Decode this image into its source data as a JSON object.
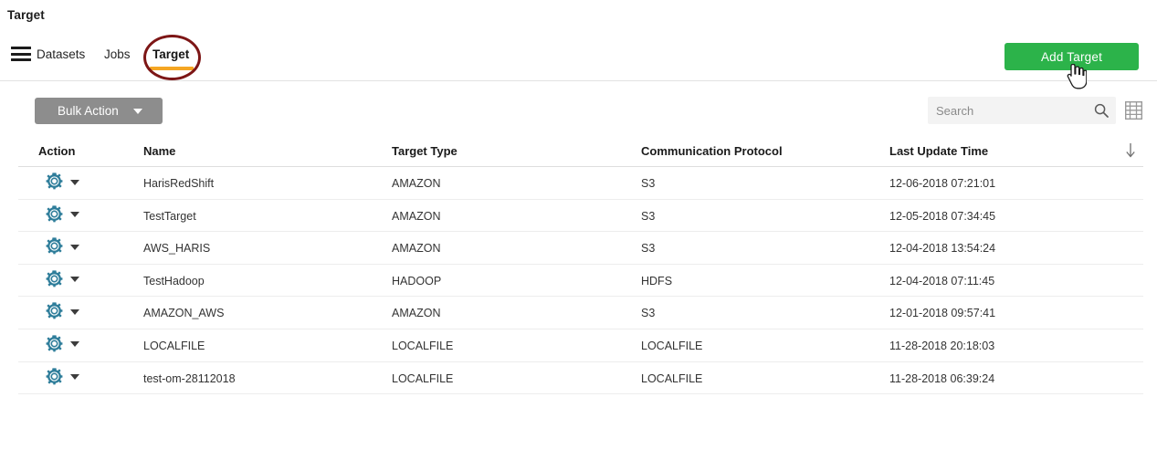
{
  "page": {
    "title": "Target"
  },
  "nav": {
    "menu_icon": "hamburger-icon",
    "tabs": [
      {
        "label": "Datasets",
        "active": false
      },
      {
        "label": "Jobs",
        "active": false
      },
      {
        "label": "Target",
        "active": true
      }
    ],
    "active_underline_color": "#f5a623",
    "annotation_color": "#7d1616"
  },
  "toolbar": {
    "add_target_label": "Add Target",
    "add_target_color": "#2cb34a",
    "bulk_action_label": "Bulk Action",
    "bulk_action_color": "#8d8d8d",
    "search_placeholder": "Search",
    "search_value": "",
    "search_icon": "search-icon",
    "grid_view_icon": "table-grid-icon",
    "cursor_icon": "pointer-hand-cursor"
  },
  "table": {
    "columns": [
      "Action",
      "Name",
      "Target Type",
      "Communication Protocol",
      "Last Update Time"
    ],
    "sort_icon": "sort-descending-arrow",
    "row_action_icon": "gear-icon",
    "row_action_caret": "chevron-down-icon",
    "rows": [
      {
        "name": "HarisRedShift",
        "target_type": "AMAZON",
        "protocol": "S3",
        "last_update": "12-06-2018 07:21:01"
      },
      {
        "name": "TestTarget",
        "target_type": "AMAZON",
        "protocol": "S3",
        "last_update": "12-05-2018 07:34:45"
      },
      {
        "name": "AWS_HARIS",
        "target_type": "AMAZON",
        "protocol": "S3",
        "last_update": "12-04-2018 13:54:24"
      },
      {
        "name": "TestHadoop",
        "target_type": "HADOOP",
        "protocol": "HDFS",
        "last_update": "12-04-2018 07:11:45"
      },
      {
        "name": "AMAZON_AWS",
        "target_type": "AMAZON",
        "protocol": "S3",
        "last_update": "12-01-2018 09:57:41"
      },
      {
        "name": "LOCALFILE",
        "target_type": "LOCALFILE",
        "protocol": "LOCALFILE",
        "last_update": "11-28-2018 20:18:03"
      },
      {
        "name": "test-om-28112018",
        "target_type": "LOCALFILE",
        "protocol": "LOCALFILE",
        "last_update": "11-28-2018 06:39:24"
      }
    ]
  }
}
